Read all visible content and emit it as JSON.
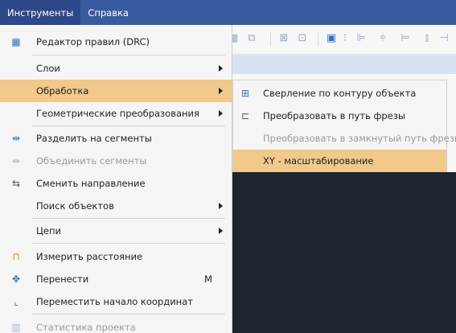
{
  "menubar": {
    "items": [
      "Инструменты",
      "Справка"
    ]
  },
  "tools_menu": {
    "items": [
      {
        "label": "Редактор правил (DRC)",
        "icon": "drc-grid-icon"
      },
      {
        "label": "Слои",
        "has_submenu": true
      },
      {
        "label": "Обработка",
        "has_submenu": true,
        "highlighted": true
      },
      {
        "label": "Геометрические преобразования",
        "has_submenu": true
      },
      {
        "label": "Разделить на сегменты",
        "icon": "split-segments-icon"
      },
      {
        "label": "Объединить сегменты",
        "icon": "join-segments-icon",
        "disabled": true
      },
      {
        "label": "Сменить направление",
        "icon": "swap-direction-icon"
      },
      {
        "label": "Поиск объектов",
        "has_submenu": true
      },
      {
        "label": "Цепи",
        "has_submenu": true
      },
      {
        "label": "Измерить расстояние",
        "icon": "ruler-icon"
      },
      {
        "label": "Перенести",
        "icon": "move-arrows-icon",
        "shortcut": "M"
      },
      {
        "label": "Переместить начало координат",
        "icon": "origin-icon"
      },
      {
        "label": "Статистика проекта",
        "icon": "statistics-icon",
        "disabled": true
      }
    ]
  },
  "processing_submenu": {
    "items": [
      {
        "label": "Сверление по контуру объекта",
        "icon": "drill-contour-icon"
      },
      {
        "label": "Преобразовать в путь фрезы",
        "icon": "mill-path-icon"
      },
      {
        "label": "Преобразовать в замкнутый путь фрезы",
        "disabled": true
      },
      {
        "label": "XY - масштабирование",
        "highlighted": true
      }
    ]
  },
  "colors": {
    "menubar": "#3a5aa0",
    "highlight": "#f1c98a",
    "canvas": "#1b2530"
  }
}
